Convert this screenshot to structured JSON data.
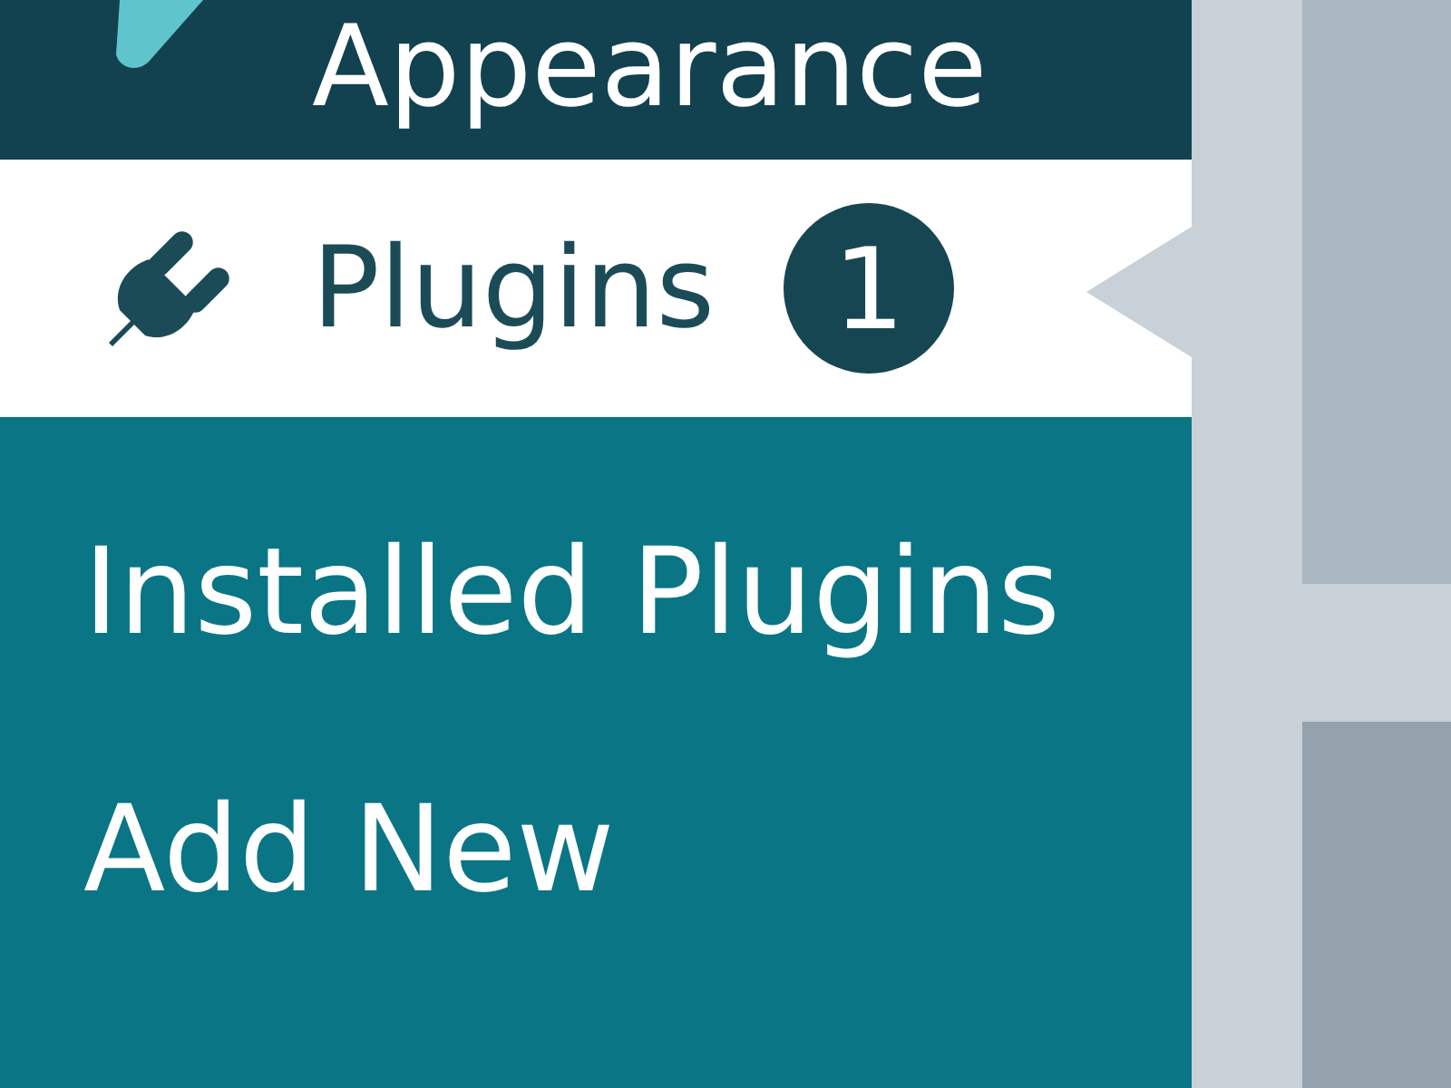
{
  "menu": {
    "items": [
      {
        "label": "Appearance",
        "selected": false
      },
      {
        "label": "Plugins",
        "selected": true,
        "badge": "1"
      }
    ],
    "submenu": [
      {
        "label": "Installed Plugins"
      },
      {
        "label": "Add New"
      }
    ]
  }
}
